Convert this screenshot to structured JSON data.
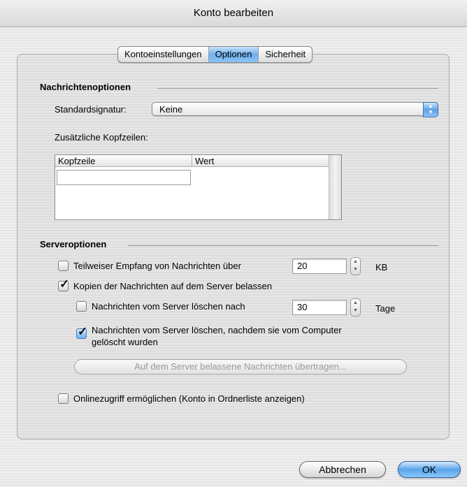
{
  "window": {
    "title": "Konto bearbeiten"
  },
  "tabs": [
    {
      "label": "Kontoeinstellungen",
      "active": false
    },
    {
      "label": "Optionen",
      "active": true
    },
    {
      "label": "Sicherheit",
      "active": false
    }
  ],
  "message_options": {
    "title": "Nachrichtenoptionen",
    "signature_label": "Standardsignatur:",
    "signature_value": "Keine",
    "headers_label": "Zusätzliche Kopfzeilen:",
    "headers_columns": [
      "Kopfzeile",
      "Wert"
    ],
    "headers_rows": []
  },
  "server_options": {
    "title": "Serveroptionen",
    "partial_receive": {
      "label": "Teilweiser Empfang von Nachrichten über",
      "checked": false,
      "value": "20",
      "unit": "KB"
    },
    "keep_copies": {
      "label": "Kopien der Nachrichten auf dem Server belassen",
      "checked": true
    },
    "delete_after": {
      "label": "Nachrichten vom Server löschen nach",
      "checked": false,
      "value": "30",
      "unit": "Tage"
    },
    "delete_when_deleted": {
      "label_line1": "Nachrichten vom Server löschen, nachdem sie vom Computer",
      "label_line2": "gelöscht wurden",
      "checked": true
    },
    "transfer_button": "Auf dem Server belassene Nachrichten übertragen...",
    "online_access": {
      "label": "Onlinezugriff ermöglichen (Konto in Ordnerliste anzeigen)",
      "checked": false
    }
  },
  "buttons": {
    "cancel": "Abbrechen",
    "ok": "OK"
  },
  "colors": {
    "accent": "#5aa4ea"
  }
}
